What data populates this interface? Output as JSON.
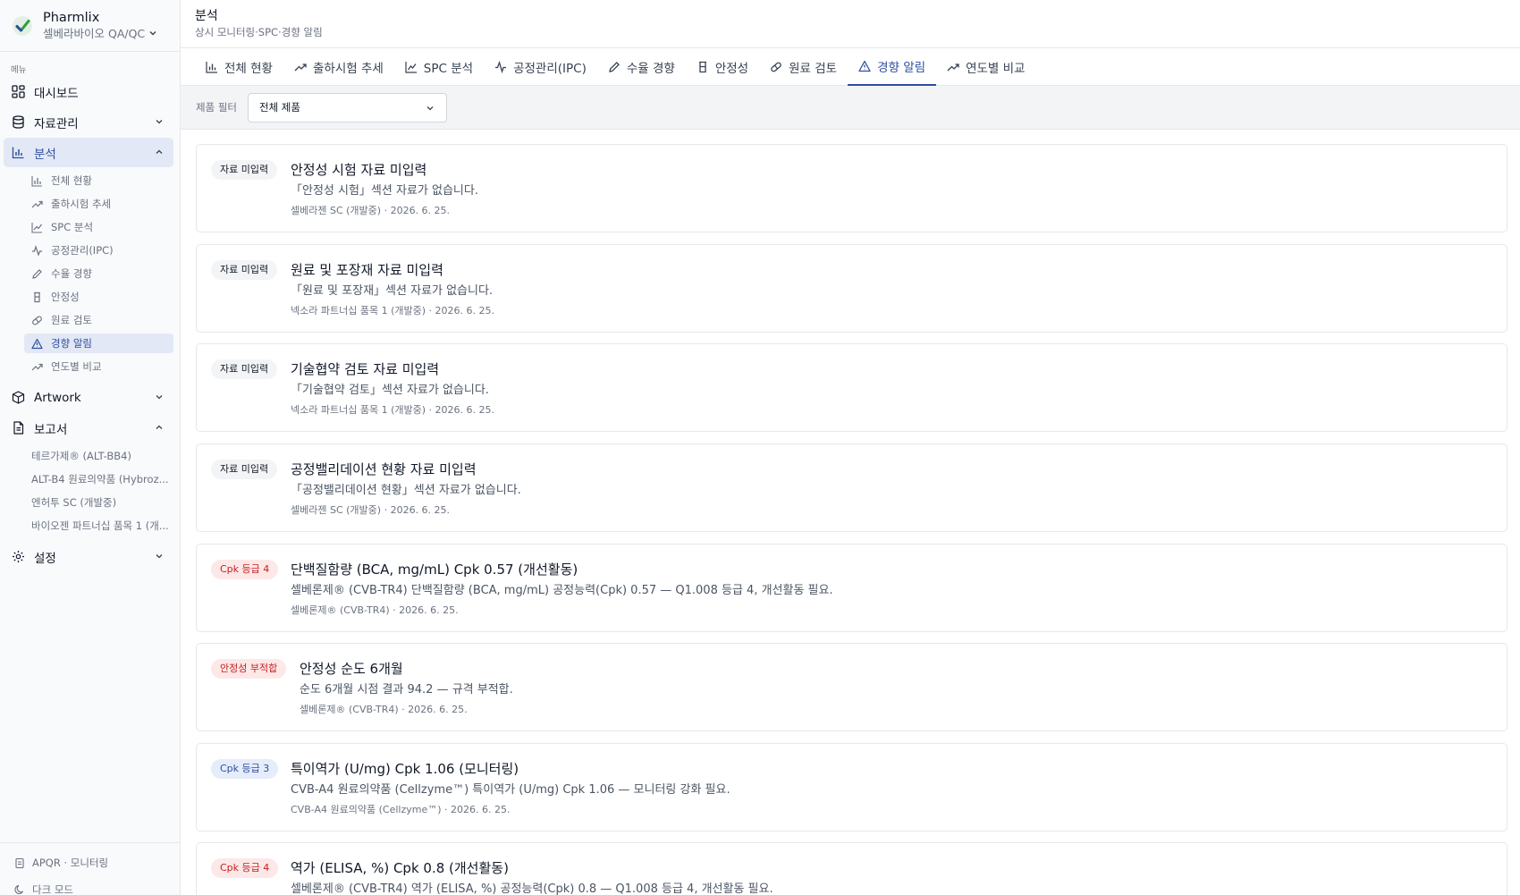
{
  "brand": {
    "name": "Pharmlix",
    "org": "셀베라바이오 QA/QC"
  },
  "sidebar": {
    "caption": "메뉴",
    "items": [
      {
        "label": "대시보드",
        "icon": "dashboard-grid-icon"
      },
      {
        "label": "자료관리",
        "icon": "database-icon"
      },
      {
        "label": "분석",
        "icon": "bar-chart-icon"
      },
      {
        "label": "Artwork",
        "icon": "package-icon"
      },
      {
        "label": "보고서",
        "icon": "document-icon"
      },
      {
        "label": "설정",
        "icon": "gear-icon"
      }
    ],
    "analysis_sub": [
      {
        "label": "전체 현황",
        "icon": "bar-chart-icon"
      },
      {
        "label": "출하시험 추세",
        "icon": "trend-up-icon"
      },
      {
        "label": "SPC 분석",
        "icon": "line-chart-icon"
      },
      {
        "label": "공정관리(IPC)",
        "icon": "pulse-icon"
      },
      {
        "label": "수율 경향",
        "icon": "pencil-icon"
      },
      {
        "label": "안정성",
        "icon": "beaker-icon"
      },
      {
        "label": "원료 검토",
        "icon": "pill-icon"
      },
      {
        "label": "경향 알림",
        "icon": "warning-icon"
      },
      {
        "label": "연도별 비교",
        "icon": "trend-up-icon"
      }
    ],
    "reports": [
      "테르가제® (ALT-BB4)",
      "ALT-B4 원료의약품 (Hybroz...",
      "엔허투 SC (개발중)",
      "바이오젠 파트너십 품목 1 (개..."
    ],
    "footer": {
      "apqr": "APQR · 모니터링",
      "dark_mode": "다크 모드"
    }
  },
  "header": {
    "title": "분석",
    "subtitle": "상시 모니터링·SPC·경향 알림"
  },
  "tabs": [
    {
      "label": "전체 현황",
      "icon": "bar-chart-icon"
    },
    {
      "label": "출하시험 추세",
      "icon": "trend-up-icon"
    },
    {
      "label": "SPC 분석",
      "icon": "line-chart-icon"
    },
    {
      "label": "공정관리(IPC)",
      "icon": "pulse-icon"
    },
    {
      "label": "수율 경향",
      "icon": "pencil-icon"
    },
    {
      "label": "안정성",
      "icon": "beaker-icon"
    },
    {
      "label": "원료 검토",
      "icon": "pill-icon"
    },
    {
      "label": "경향 알림",
      "icon": "warning-icon"
    },
    {
      "label": "연도별 비교",
      "icon": "trend-up-icon"
    }
  ],
  "filter": {
    "label": "제품 필터",
    "value": "전체 제품"
  },
  "alerts": [
    {
      "badge": "자료 미입력",
      "badge_color": "#111827",
      "title": "안정성 시험 자료 미입력",
      "desc": "「안정성 시험」섹션 자료가 없습니다.",
      "meta": "셀베라젠 SC (개발중) · 2026. 6. 25."
    },
    {
      "badge": "자료 미입력",
      "badge_color": "#111827",
      "title": "원료 및 포장재 자료 미입력",
      "desc": "「원료 및 포장재」섹션 자료가 없습니다.",
      "meta": "넥소라 파트너십 품목 1 (개발중) · 2026. 6. 25."
    },
    {
      "badge": "자료 미입력",
      "badge_color": "#111827",
      "title": "기술협약 검토 자료 미입력",
      "desc": "「기술협약 검토」섹션 자료가 없습니다.",
      "meta": "넥소라 파트너십 품목 1 (개발중) · 2026. 6. 25."
    },
    {
      "badge": "자료 미입력",
      "badge_color": "#111827",
      "title": "공정밸리데이션 현황 자료 미입력",
      "desc": "「공정밸리데이션 현황」섹션 자료가 없습니다.",
      "meta": "셀베라젠 SC (개발중) · 2026. 6. 25."
    },
    {
      "badge": "Cpk 등급 4",
      "badge_color": "#c81e1e",
      "title": "단백질함량 (BCA, mg/mL) Cpk 0.57 (개선활동)",
      "desc": "셀베론제® (CVB-TR4) 단백질함량 (BCA, mg/mL) 공정능력(Cpk) 0.57 — Q1.008 등급 4, 개선활동 필요.",
      "meta": "셀베론제® (CVB-TR4) · 2026. 6. 25."
    },
    {
      "badge": "안정성 부적합",
      "badge_color": "#c81e1e",
      "title": "안정성 순도 6개월",
      "desc": "순도 6개월 시점 결과 94.2 — 규격 부적합.",
      "meta": "셀베론제® (CVB-TR4) · 2026. 6. 25."
    },
    {
      "badge": "Cpk 등급 3",
      "badge_color": "#2d4fa1",
      "title": "특이역가 (U/mg) Cpk 1.06 (모니터링)",
      "desc": "CVB-A4 원료의약품 (Cellzyme™) 특이역가 (U/mg) Cpk 1.06 — 모니터링 강화 필요.",
      "meta": "CVB-A4 원료의약품 (Cellzyme™) · 2026. 6. 25."
    },
    {
      "badge": "Cpk 등급 4",
      "badge_color": "#c81e1e",
      "title": "역가 (ELISA, %) Cpk 0.8 (개선활동)",
      "desc": "셀베론제® (CVB-TR4) 역가 (ELISA, %) 공정능력(Cpk) 0.8 — Q1.008 등급 4, 개선활동 필요.",
      "meta": ""
    }
  ]
}
